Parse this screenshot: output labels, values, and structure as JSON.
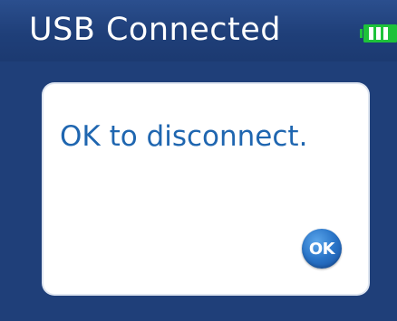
{
  "header": {
    "title": "USB Connected",
    "battery_icon": "battery-full-icon",
    "battery_color": "#1ec23a"
  },
  "dialog": {
    "message": "OK to disconnect.",
    "ok_label": "OK",
    "ok_icon": "ok-circle-icon"
  },
  "colors": {
    "background": "#1f3f79",
    "dialog_background": "#ffffff",
    "message_text": "#1f66b0",
    "button_blue": "#2a75c8"
  }
}
